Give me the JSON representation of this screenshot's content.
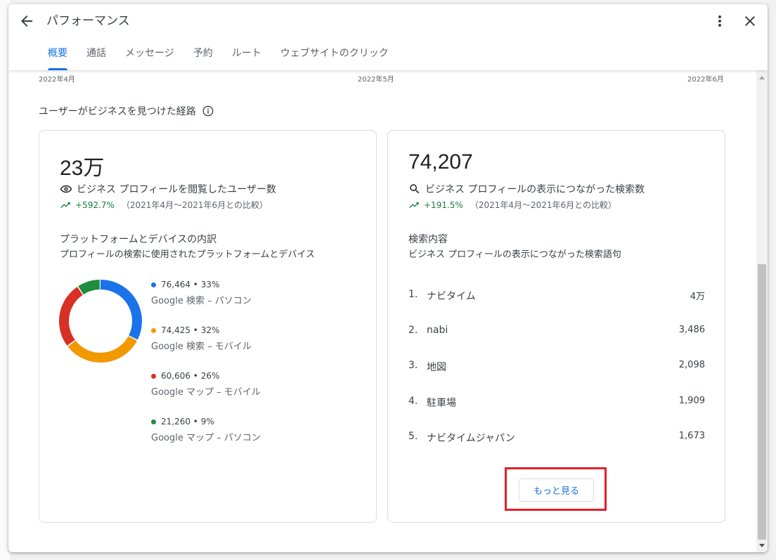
{
  "dialog": {
    "title": "パフォーマンス",
    "tabs": [
      {
        "label": "概要"
      },
      {
        "label": "通話"
      },
      {
        "label": "メッセージ"
      },
      {
        "label": "予約"
      },
      {
        "label": "ルート"
      },
      {
        "label": "ウェブサイトのクリック"
      }
    ],
    "active_tab": 0
  },
  "axis": {
    "labels": [
      "2022年4月",
      "2022年5月",
      "2022年6月"
    ]
  },
  "section": {
    "title": "ユーザーがビジネスを見つけた経路"
  },
  "profile_card": {
    "value": "23万",
    "label": "ビジネス プロフィールを閲覧したユーザー数",
    "change": "+592.7%",
    "compare": "（2021年4月～2021年6月との比較）",
    "breakdown_title": "プラットフォームとデバイスの内訳",
    "breakdown_desc": "プロフィールの検索に使用されたプラットフォームとデバイス",
    "chart_data": {
      "type": "pie",
      "series": [
        {
          "name": "Google 検索 – パソコン",
          "value": 76464,
          "percent": 33,
          "label": "76,464 • 33%",
          "color": "#1a73e8"
        },
        {
          "name": "Google 検索 – モバイル",
          "value": 74425,
          "percent": 32,
          "label": "74,425 • 32%",
          "color": "#f29900"
        },
        {
          "name": "Google マップ – モバイル",
          "value": 60606,
          "percent": 26,
          "label": "60,606 • 26%",
          "color": "#d93025"
        },
        {
          "name": "Google マップ – パソコン",
          "value": 21260,
          "percent": 9,
          "label": "21,260 • 9%",
          "color": "#1e8e3e"
        }
      ]
    }
  },
  "search_card": {
    "value": "74,207",
    "label": "ビジネス プロフィールの表示につながった検索数",
    "change": "+191.5%",
    "compare": "（2021年4月～2021年6月との比較）",
    "list_title": "検索内容",
    "list_desc": "ビジネス プロフィールの表示につながった検索語句",
    "rows": [
      {
        "rank": "1.",
        "term": "ナビタイム",
        "count": "4万"
      },
      {
        "rank": "2.",
        "term": "nabi",
        "count": "3,486"
      },
      {
        "rank": "3.",
        "term": "地図",
        "count": "2,098"
      },
      {
        "rank": "4.",
        "term": "駐車場",
        "count": "1,909"
      },
      {
        "rank": "5.",
        "term": "ナビタイムジャパン",
        "count": "1,673"
      }
    ],
    "more_label": "もっと見る"
  },
  "colors": {
    "accent": "#1a73e8",
    "positive": "#188038",
    "highlight": "#e0202a"
  }
}
